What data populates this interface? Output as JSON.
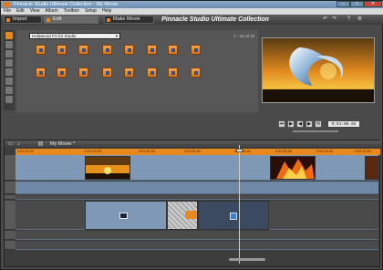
{
  "window": {
    "title": "Pinnacle Studio Ultimate Collection - My Movie"
  },
  "menu": [
    "File",
    "Edit",
    "View",
    "Album",
    "Toolbox",
    "Setup",
    "Help"
  ],
  "tabs": [
    {
      "label": "Import"
    },
    {
      "label": "Edit"
    },
    {
      "label": "Make Movie"
    }
  ],
  "app_title": "Pinnacle Studio Ultimate Collection",
  "library": {
    "dropdown_value": "Hollywood FX for Studio",
    "count_text": "1 - 16 of 16"
  },
  "transport": {
    "timecode": "0:01:06.02"
  },
  "timeline": {
    "project_name": "My Movie *",
    "ruler_labels": [
      "0:01:00.00",
      "0:01:10.00",
      "0:01:20.00",
      "0:01:30.00",
      "0:01:40.00",
      "0:01:50.00",
      "0:02:00.00",
      "0:02:10.00"
    ]
  },
  "colors": {
    "accent": "#e8891e",
    "track": "#7f98b5",
    "panel": "#575757"
  }
}
